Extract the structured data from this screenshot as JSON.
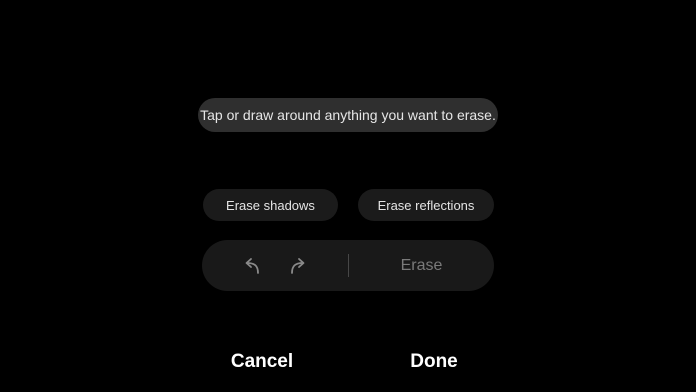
{
  "hint": {
    "text": "Tap or draw around anything you want to erase."
  },
  "options": {
    "erase_shadows": "Erase shadows",
    "erase_reflections": "Erase reflections"
  },
  "toolbar": {
    "undo_icon": "undo-icon",
    "redo_icon": "redo-icon",
    "erase_label": "Erase",
    "erase_enabled": false
  },
  "footer": {
    "cancel_label": "Cancel",
    "done_label": "Done"
  },
  "colors": {
    "background": "#000000",
    "pill": "#191919",
    "text_primary": "#ffffff",
    "text_disabled": "#7a7a7a"
  }
}
